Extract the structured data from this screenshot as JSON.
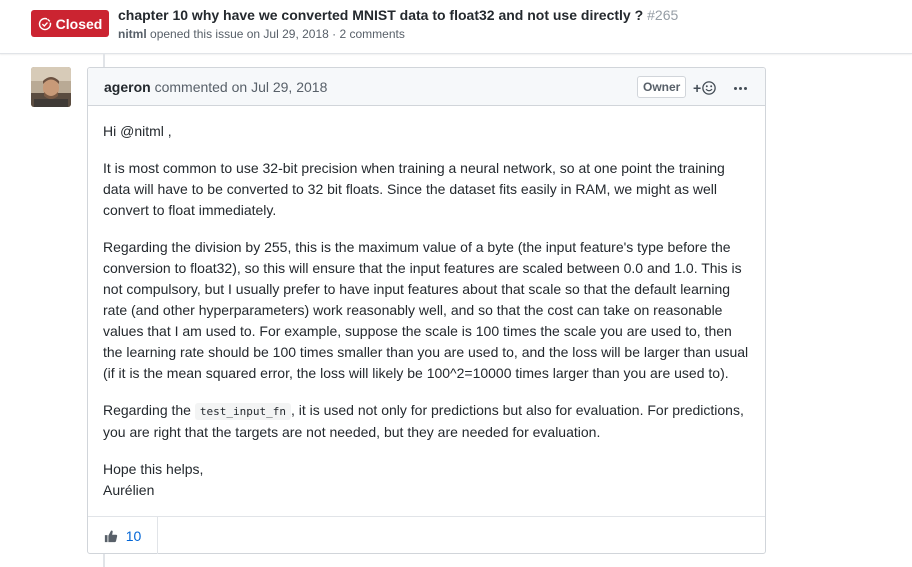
{
  "issue": {
    "state": "Closed",
    "title": "chapter 10 why have we converted MNIST data to float32 and not use directly ?",
    "number": "#265",
    "author": "nitml",
    "meta_text": "opened this issue on Jul 29, 2018 · 2 comments",
    "state_color": "#cb2431"
  },
  "comment": {
    "author": "ageron",
    "action": "commented on Jul 29, 2018",
    "role_label": "Owner",
    "reaction_add_icon": "smiley-icon",
    "menu_icon": "kebab-horizontal-icon",
    "paragraphs": [
      "Hi @nitml ,",
      "It is most common to use 32-bit precision when training a neural network, so at one point the training data will have to be converted to 32 bit floats. Since the dataset fits easily in RAM, we might as well convert to float immediately.",
      "Regarding the division by 255, this is the maximum value of a byte (the input feature's type before the conversion to float32), so this will ensure that the input features are scaled between 0.0 and 1.0. This is not compulsory, but I usually prefer to have input features about that scale so that the default learning rate (and other hyperparameters) work reasonably well, and so that the cost can take on reasonable values that I am used to. For example, suppose the scale is 100 times the scale you are used to, then the learning rate should be 100 times smaller than you are used to, and the loss will be larger than usual (if it is the mean squared error, the loss will likely be 100^2=10000 times larger than you are used to)."
    ],
    "p4_before": "Regarding the",
    "p4_code": "test_input_fn",
    "p4_after": ", it is used not only for predictions but also for evaluation. For predictions, you are right that the targets are not needed, but they are needed for evaluation.",
    "closing_line1": "Hope this helps,",
    "closing_line2": "Aurélien",
    "reaction": {
      "icon": "thumbsup-icon",
      "count": "10"
    }
  }
}
